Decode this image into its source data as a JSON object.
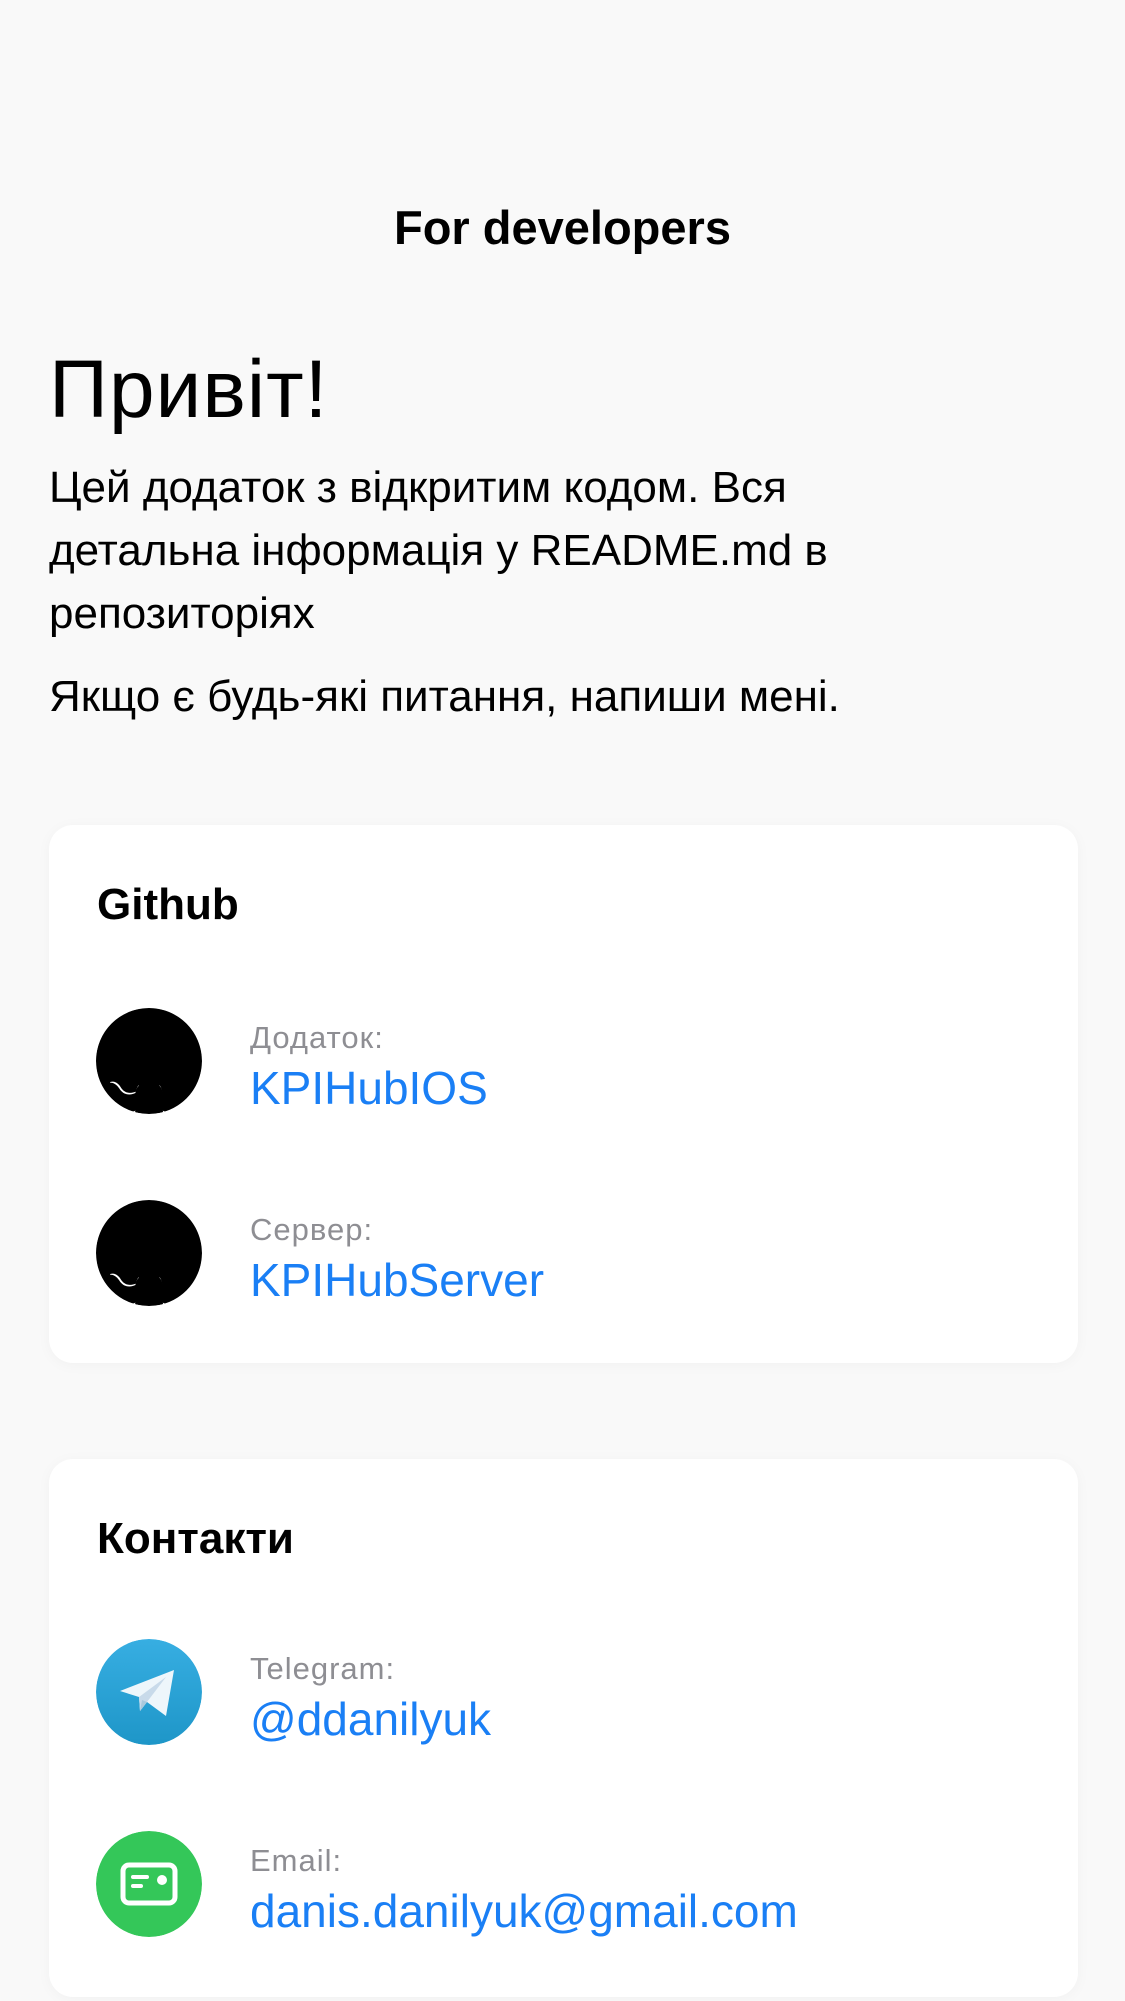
{
  "nav": {
    "title": "For developers"
  },
  "intro": {
    "title": "Привіт!",
    "text": "Цей додаток з відкритим кодом. Вся детальна інформація у README.md в репозиторіях",
    "text2": "Якщо є будь-які питання, напиши мені."
  },
  "github": {
    "title": "Github",
    "items": [
      {
        "label": "Додаток:",
        "value": "KPIHubIOS",
        "icon": "github-icon"
      },
      {
        "label": "Сервер:",
        "value": "KPIHubServer",
        "icon": "github-icon"
      }
    ]
  },
  "contacts": {
    "title": "Контакти",
    "items": [
      {
        "label": "Telegram:",
        "value": "@ddanilyuk",
        "icon": "telegram-icon"
      },
      {
        "label": "Email:",
        "value": "danis.danilyuk@gmail.com",
        "icon": "email-icon"
      }
    ]
  },
  "colors": {
    "background": "#f9f9f9",
    "card": "#ffffff",
    "link": "#1a7ff5",
    "secondary": "#8e8e93",
    "telegram": "#2aa3df",
    "email": "#34c759"
  }
}
